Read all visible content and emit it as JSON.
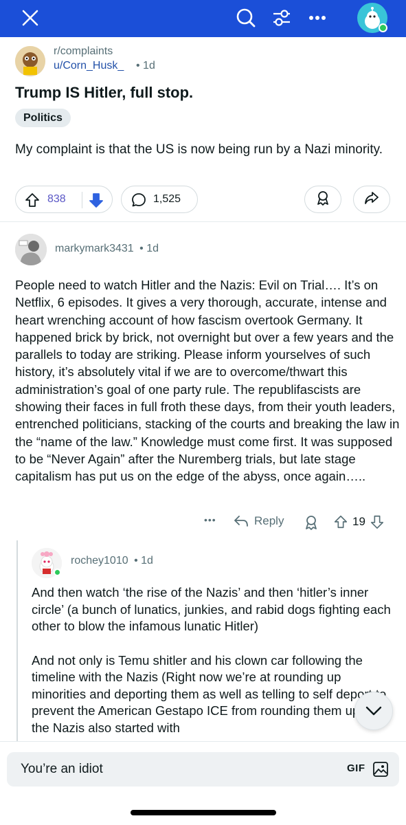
{
  "topbar": {
    "background": "#1b4fd8",
    "icons": [
      "close-icon",
      "search-icon",
      "filter-icon",
      "more-icon",
      "avatar"
    ]
  },
  "post": {
    "subreddit": "r/complaints",
    "author": "u/Corn_Husk_",
    "time": "• 1d",
    "title": "Trump IS Hitler, full stop.",
    "flair": "Politics",
    "body": "My complaint is that the US is now being run by a Nazi minority.",
    "upvotes": "838",
    "comments": "1,525"
  },
  "comment1": {
    "user": "markymark3431",
    "time": "• 1d",
    "body": "People need to watch Hitler and the Nazis: Evil on Trial…. It’s on Netflix, 6 episodes. It gives a very thorough, accurate, intense and heart wrenching account of how fascism overtook Germany. It happened brick by brick, not overnight but over a few years and the parallels to today are striking. Please inform yourselves of such history, it’s absolutely vital if we are to overcome/thwart this administration’s goal of one party rule. The republifascists are showing their faces in full froth these days, from their youth leaders, entrenched politicians, stacking of the courts and breaking the law in the “name of the law.” Knowledge must come first. It was supposed to be “Never Again” after the Nuremberg trials, but late stage capitalism has put us on the edge of the abyss, once again…..",
    "more_label": "•••",
    "reply_label": "Reply",
    "score": "19"
  },
  "comment2": {
    "user": "rochey1010",
    "time": "• 1d",
    "para1": "And then watch ‘the rise of the Nazis’ and then ‘hitler’s inner circle’ (a bunch of lunatics, junkies, and rabid dogs fighting each other to blow the infamous lunatic Hitler)",
    "para2": "And not only is Temu shitler and his clown car following the timeline with the Nazis (Right now we’re at rounding up minorities and deporting them as well as telling to self deport to prevent the American Gestapo ICE from rounding them up) but the Nazis also started with"
  },
  "composer": {
    "placeholder": "You’re an idiot",
    "gif_label": "GIF"
  },
  "colors": {
    "accent": "#1b4fd8",
    "upvote_count": "#5a57c6",
    "downvote": "#2f62e0",
    "muted": "#576f76"
  }
}
